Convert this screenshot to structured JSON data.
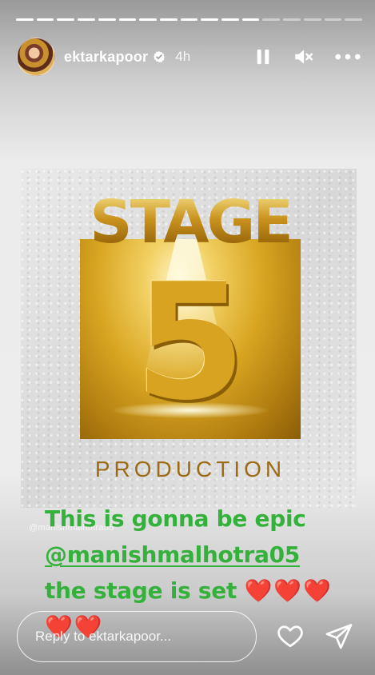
{
  "story": {
    "progress": {
      "segments_total": 17,
      "segments_completed": 12
    }
  },
  "header": {
    "username": "ektarkapoor",
    "verified": true,
    "time_ago": "4h",
    "icons": {
      "avatar": "profile-avatar",
      "verified": "verified-badge-icon",
      "pause": "pause-icon",
      "mute": "muted-speaker-icon",
      "more": "more-dots-icon"
    }
  },
  "poster": {
    "title_word": "STAGE",
    "number": "5",
    "subtitle": "PRODUCTION",
    "watermark": "@manishmalhotra05",
    "colors": {
      "gold": "#d7a321",
      "gold_dark": "#8a5d08",
      "bronze_text": "#9c6b14"
    }
  },
  "caption": {
    "line1": "This is gonna be epic",
    "mention": "@manishmalhotra05",
    "line3": "the stage is set",
    "hearts_line3": "❤️❤️❤️",
    "hearts_line4": "❤️❤️",
    "color": "#33b13a"
  },
  "footer": {
    "reply_placeholder": "Reply to ektarkapoor...",
    "icons": {
      "like": "heart-outline-icon",
      "send": "send-paper-plane-icon"
    }
  }
}
